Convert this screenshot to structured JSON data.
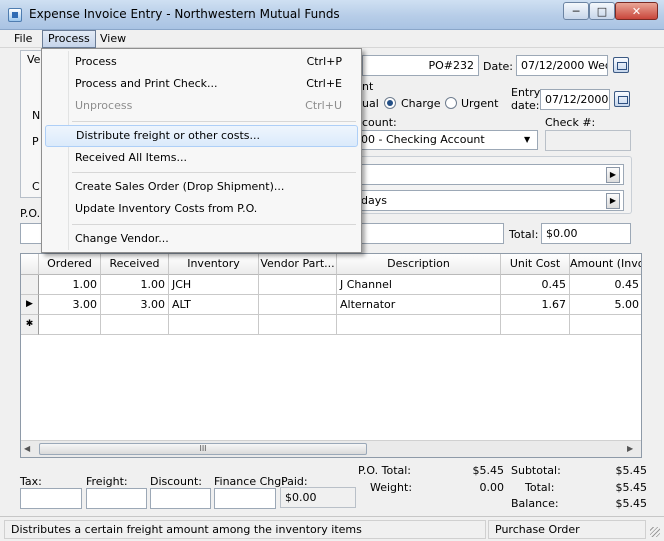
{
  "window": {
    "title": "Expense Invoice Entry - Northwestern Mutual Funds",
    "controls": {
      "minimize": "─",
      "maximize": "□",
      "close": "✕"
    }
  },
  "menubar": {
    "file": "File",
    "process": "Process",
    "view": "View"
  },
  "process_menu": {
    "items": [
      {
        "label": "Process",
        "shortcut": "Ctrl+P",
        "enabled": true
      },
      {
        "label": "Process and Print Check...",
        "shortcut": "Ctrl+E",
        "enabled": true
      },
      {
        "label": "Unprocess",
        "shortcut": "Ctrl+U",
        "enabled": false
      },
      {
        "label": "Distribute freight or other costs...",
        "shortcut": "",
        "enabled": true,
        "highlighted": true
      },
      {
        "label": "Received All Items...",
        "shortcut": "",
        "enabled": true
      },
      {
        "label": "Create Sales Order (Drop Shipment)...",
        "shortcut": "",
        "enabled": true
      },
      {
        "label": "Update Inventory Costs from P.O.",
        "shortcut": "",
        "enabled": true
      },
      {
        "label": "Change Vendor...",
        "shortcut": "",
        "enabled": true
      }
    ]
  },
  "header": {
    "vendor_tab_label": "Ve",
    "po_number": "PO#232",
    "date_label": "Date:",
    "date_value": "07/12/2000 Wed",
    "payment_method_partial": "nt",
    "manual_label": "ual",
    "charge_label": "Charge",
    "urgent_label": "Urgent",
    "entry_date_label_1": "Entry",
    "entry_date_label_2": "date:",
    "entry_date_value": "07/12/2000",
    "account_label": "count:",
    "account_value": "00 - Checking Account",
    "check_label": "Check #:",
    "check_value": "",
    "terms_value": "",
    "days_value": "days",
    "left_labels": {
      "n": "N",
      "p": "P",
      "c": "C"
    },
    "po_label": "P.O.",
    "total_label": "Total:",
    "total_value": "$0.00"
  },
  "grid": {
    "columns": [
      "Ordered",
      "Received",
      "Inventory",
      "Vendor Part...",
      "Description",
      "Unit Cost",
      "Amount (Invoi"
    ],
    "rows": [
      {
        "marker": "",
        "ordered": "1.00",
        "received": "1.00",
        "inventory": "JCH",
        "vendor_part": "",
        "description": "J Channel",
        "unit_cost": "0.45",
        "amount": "0.45"
      },
      {
        "marker": "▶",
        "ordered": "3.00",
        "received": "3.00",
        "inventory": "ALT",
        "vendor_part": "",
        "description": "Alternator",
        "unit_cost": "1.67",
        "amount": "5.00"
      },
      {
        "marker": "✱",
        "ordered": "",
        "received": "",
        "inventory": "",
        "vendor_part": "",
        "description": "",
        "unit_cost": "",
        "amount": ""
      }
    ],
    "scroll_left": "◀",
    "scroll_right": "▶",
    "thumb_grip": "III"
  },
  "footer": {
    "tax_label": "Tax:",
    "freight_label": "Freight:",
    "discount_label": "Discount:",
    "finance_label": "Finance Chg:",
    "paid_label": "Paid:",
    "paid_value": "$0.00",
    "po_total_label": "P.O. Total:",
    "po_total_value": "$5.45",
    "weight_label": "Weight:",
    "weight_value": "0.00",
    "subtotal_label": "Subtotal:",
    "subtotal_value": "$5.45",
    "total_label": "Total:",
    "total_value": "$5.45",
    "balance_label": "Balance:",
    "balance_value": "$5.45"
  },
  "statusbar": {
    "message": "Distributes a certain freight amount among the inventory items",
    "mode": "Purchase Order"
  }
}
